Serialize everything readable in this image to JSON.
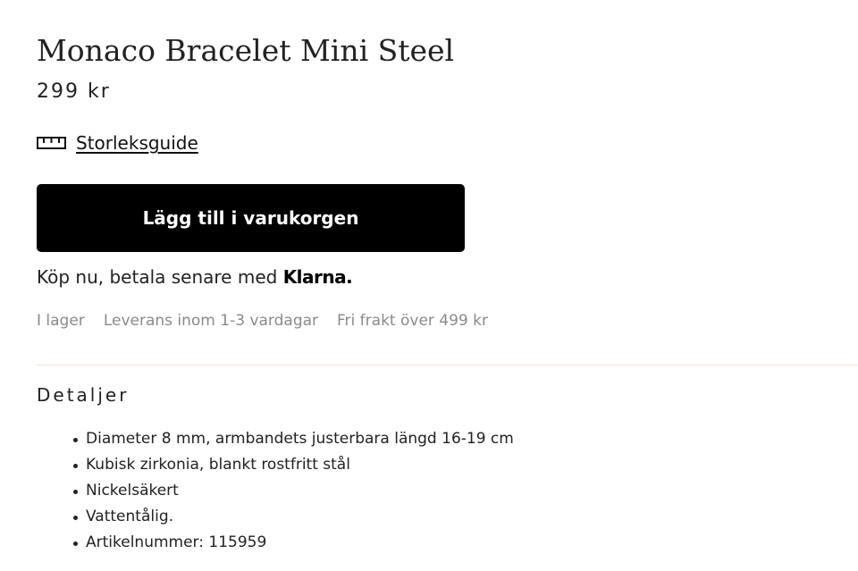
{
  "product": {
    "title": "Monaco Bracelet Mini Steel",
    "price": "299 kr"
  },
  "size_guide": {
    "icon": "ruler-icon",
    "label": "Storleksguide"
  },
  "add_to_cart": {
    "label": "Lägg till i varukorgen",
    "background": "#000000",
    "text_color": "#ffffff"
  },
  "klarna": {
    "text": "Köp nu, betala senare med ",
    "logo_text": "Klarna."
  },
  "status": {
    "stock": "I lager",
    "delivery": "Leverans inom 1-3 vardagar",
    "shipping": "Fri frakt över 499 kr"
  },
  "details": {
    "heading": "Detaljer",
    "items": [
      "Diameter 8 mm, armbandets justerbara längd 16-19 cm",
      "Kubisk zirkonia, blankt rostfritt stål",
      "Nickelsäkert",
      "Vattentålig.",
      "Artikelnummer: 115959"
    ]
  },
  "colors": {
    "divider": "#f1dfd5",
    "muted_text": "#8a8a8a"
  }
}
